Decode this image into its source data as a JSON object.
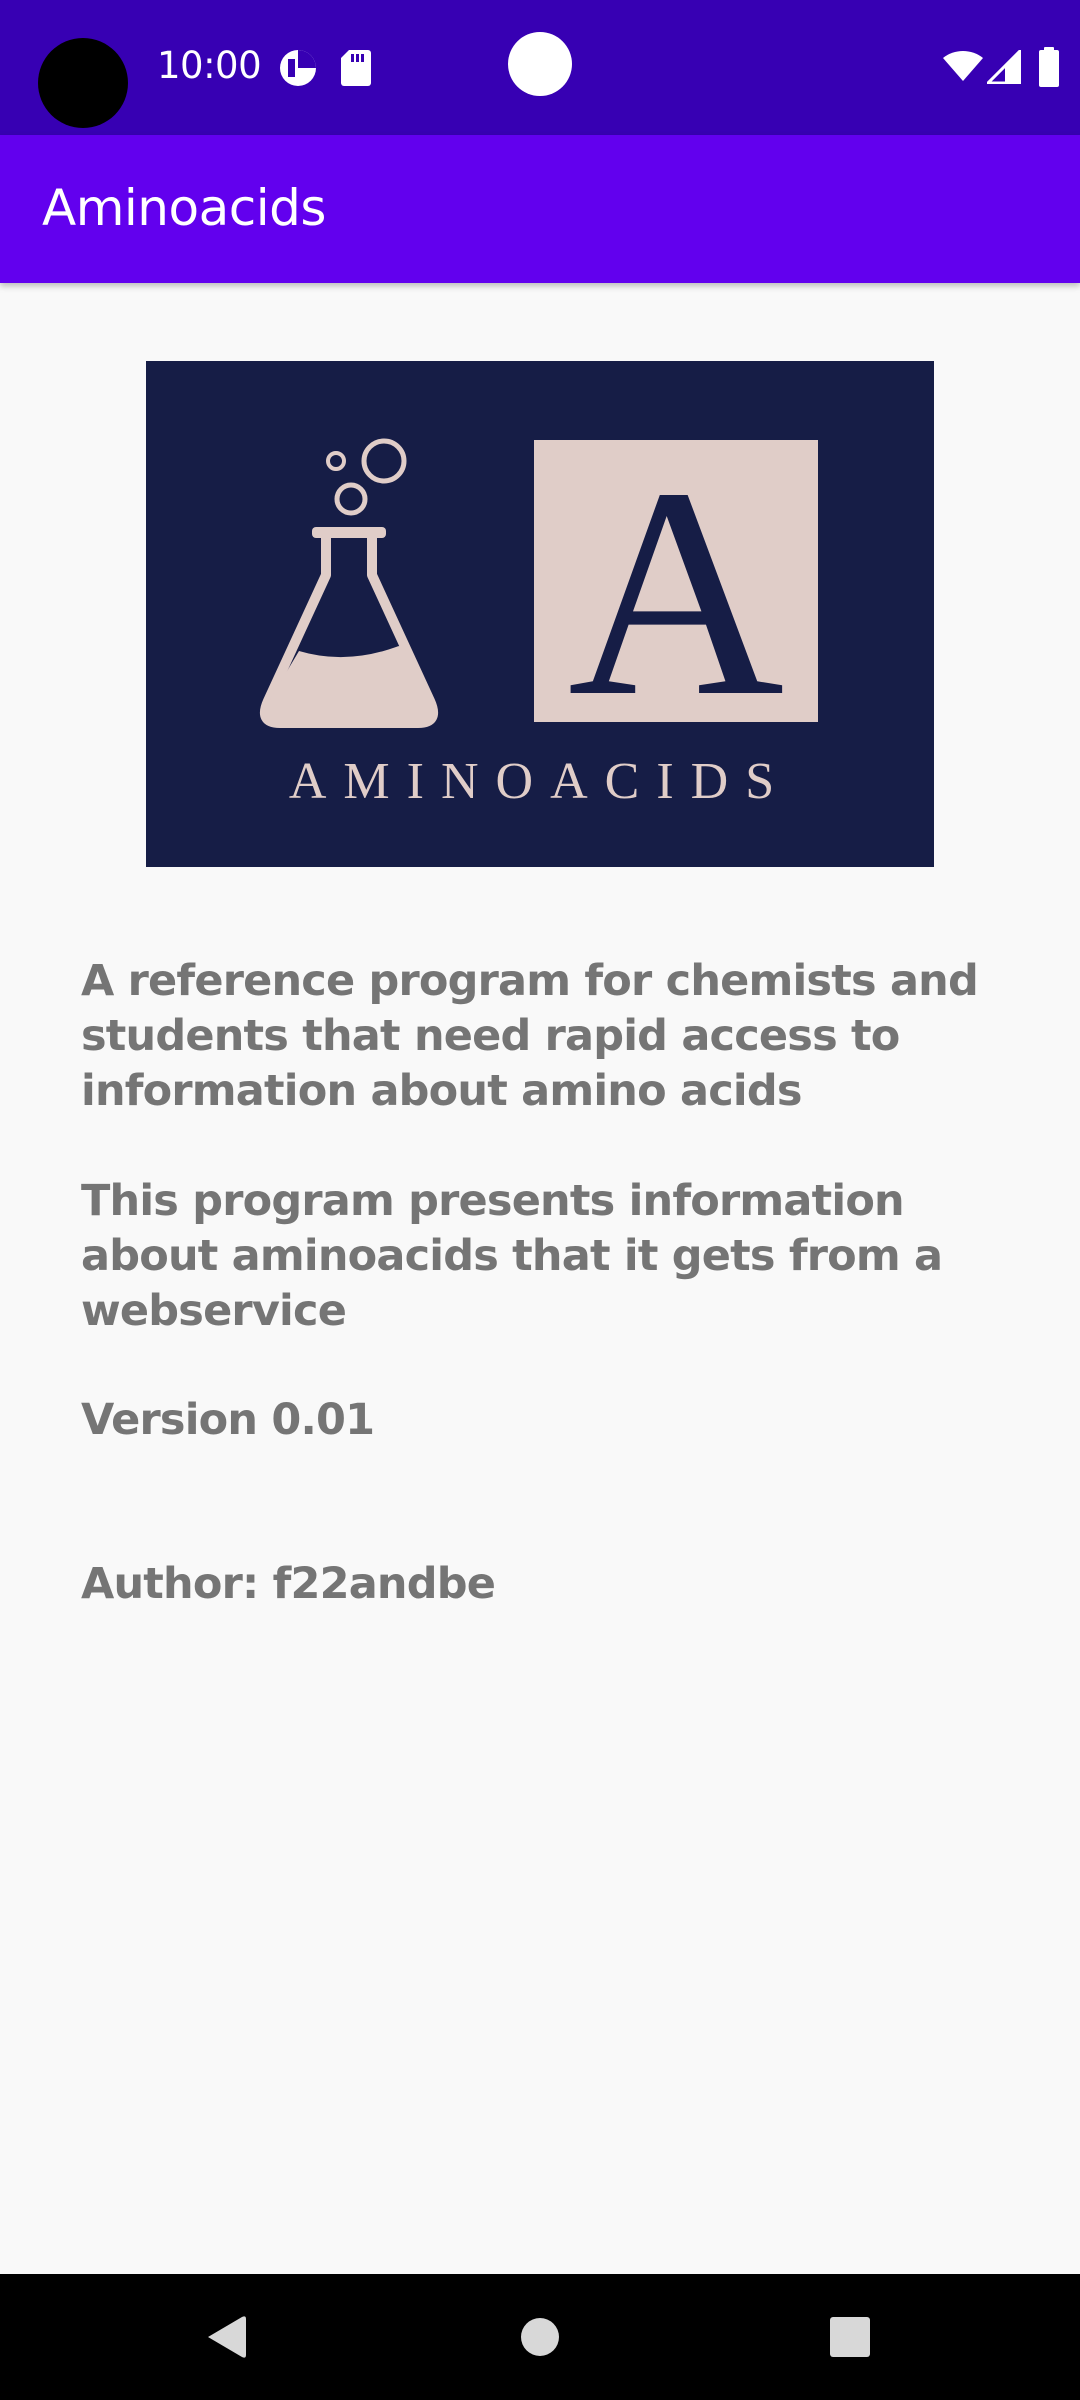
{
  "status_bar": {
    "time": "10:00",
    "icons": [
      "data-saver-icon",
      "sd-card-icon",
      "wifi-icon",
      "cellular-signal-icon",
      "battery-icon"
    ],
    "background": "#3700b3"
  },
  "app_bar": {
    "title": "Aminoacids",
    "background": "#6200ee"
  },
  "logo": {
    "letter": "A",
    "wordmark": "AMINOACIDS",
    "background": "#161d46",
    "accent": "#e0cdc8"
  },
  "about": {
    "description": "A reference program for chemists and students that need rapid access to information about amino acids",
    "details": "This program presents information about aminoacids that it gets from a webservice",
    "version": "Version 0.01",
    "author": "Author: f22andbe",
    "text_color": "#757575"
  },
  "nav_bar": {
    "buttons": [
      "back-icon",
      "home-icon",
      "recents-icon"
    ]
  }
}
